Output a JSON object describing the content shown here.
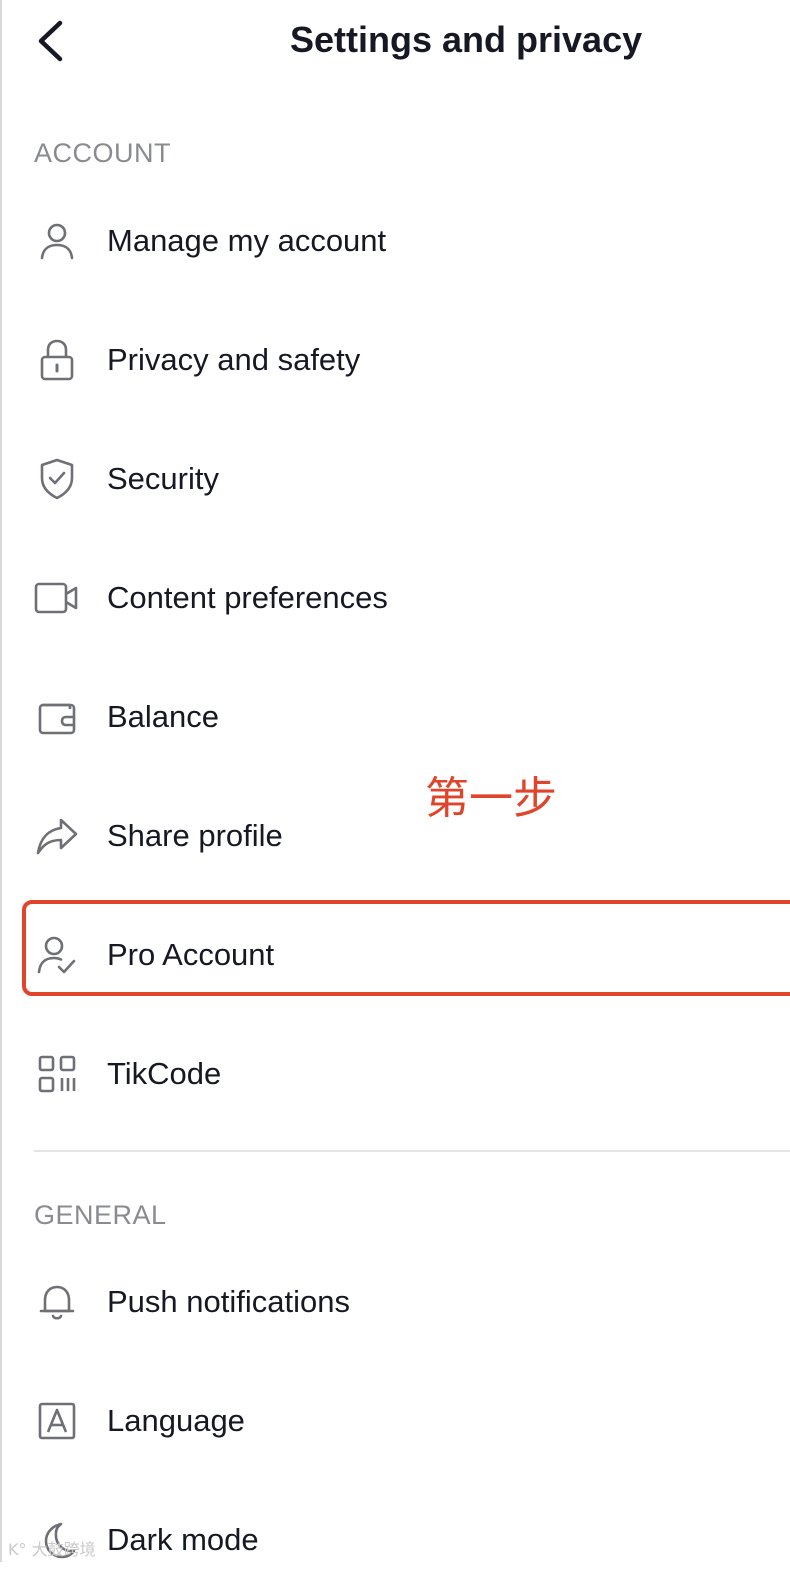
{
  "header": {
    "title": "Settings and privacy",
    "back_icon": "chevron-left-icon"
  },
  "sections": {
    "account": {
      "title": "ACCOUNT",
      "items": [
        {
          "label": "Manage my account",
          "icon": "person-icon"
        },
        {
          "label": "Privacy and safety",
          "icon": "lock-icon"
        },
        {
          "label": "Security",
          "icon": "shield-check-icon"
        },
        {
          "label": "Content preferences",
          "icon": "video-camera-icon"
        },
        {
          "label": "Balance",
          "icon": "wallet-icon"
        },
        {
          "label": "Share profile",
          "icon": "share-arrow-icon"
        },
        {
          "label": "Pro Account",
          "icon": "person-check-icon"
        },
        {
          "label": "TikCode",
          "icon": "qr-code-icon"
        }
      ]
    },
    "general": {
      "title": "GENERAL",
      "items": [
        {
          "label": "Push notifications",
          "icon": "bell-icon"
        },
        {
          "label": "Language",
          "icon": "language-a-icon"
        },
        {
          "label": "Dark mode",
          "icon": "moon-icon"
        }
      ]
    }
  },
  "annotation": {
    "text": "第一步",
    "color": "#e0442a"
  },
  "watermark": {
    "text": "K° 大鼓跨境"
  },
  "colors": {
    "text_primary": "#161823",
    "text_secondary": "#8a8b91",
    "highlight": "#e0442a",
    "divider": "#e3e3e4"
  }
}
